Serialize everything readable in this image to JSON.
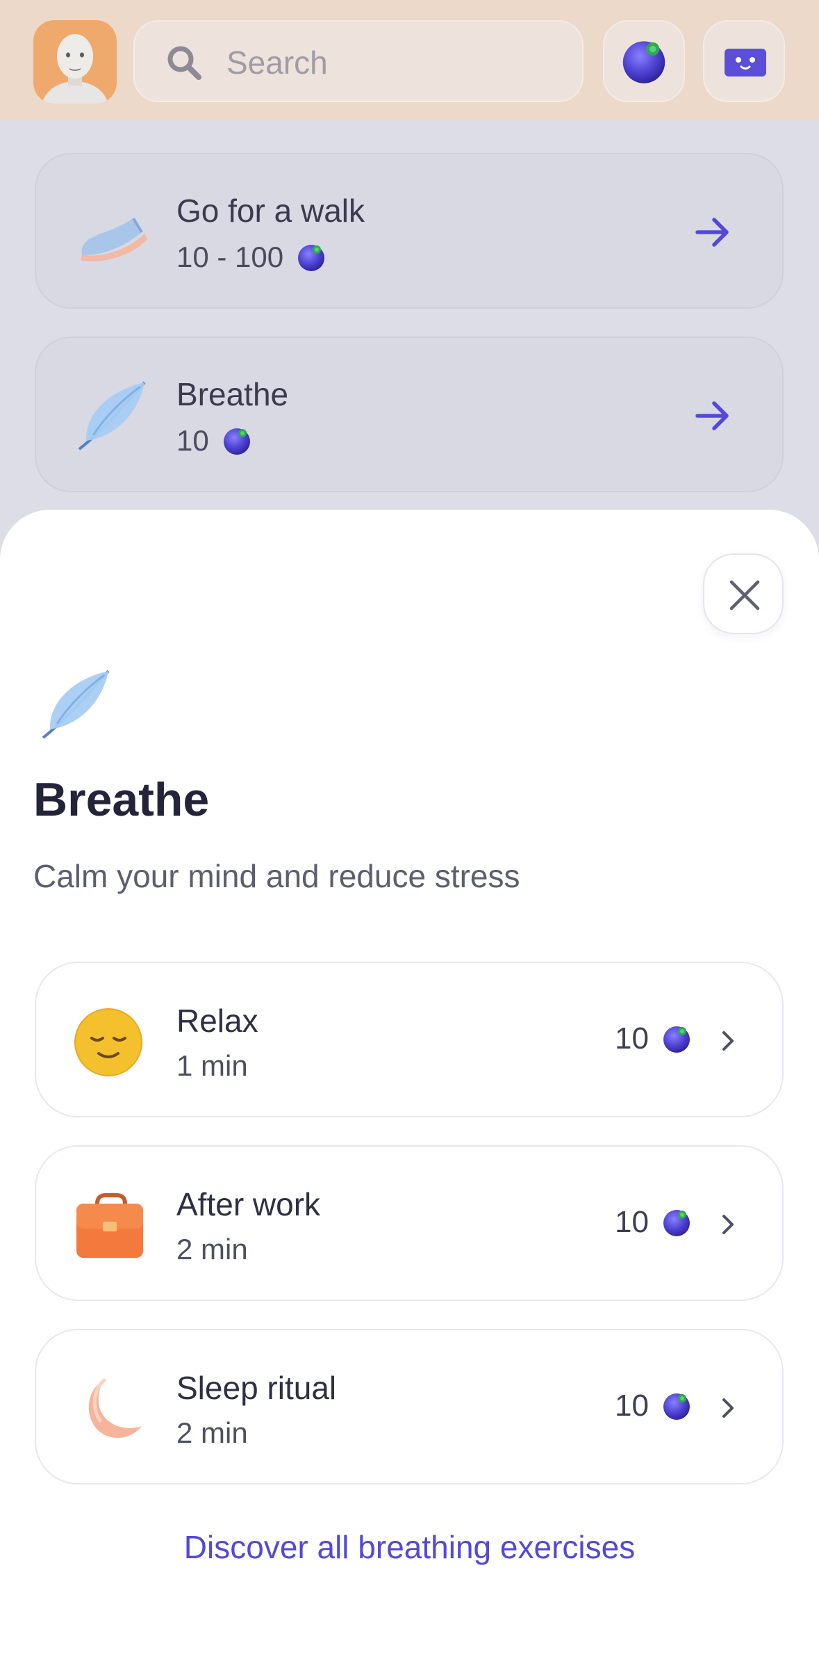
{
  "search": {
    "placeholder": "Search"
  },
  "background_cards": [
    {
      "title": "Go for a walk",
      "reward": "10 - 100"
    },
    {
      "title": "Breathe",
      "reward": "10"
    }
  ],
  "sheet": {
    "title": "Breathe",
    "subtitle": "Calm your mind and reduce stress",
    "items": [
      {
        "name": "Relax",
        "duration": "1 min",
        "reward": "10"
      },
      {
        "name": "After work",
        "duration": "2 min",
        "reward": "10"
      },
      {
        "name": "Sleep ritual",
        "duration": "2 min",
        "reward": "10"
      }
    ],
    "discover_link": "Discover all breathing exercises"
  },
  "colors": {
    "accent": "#5448d6",
    "coin": "#4b3fd1",
    "topbar": "#ecd9c9"
  },
  "icons": [
    "avatar",
    "search-icon",
    "blueberry-coin-icon",
    "chat-bot-icon",
    "sneaker-icon",
    "feather-icon",
    "arrow-right-icon",
    "close-icon",
    "sleepy-face-icon",
    "briefcase-icon",
    "moon-icon",
    "chevron-right-icon"
  ]
}
